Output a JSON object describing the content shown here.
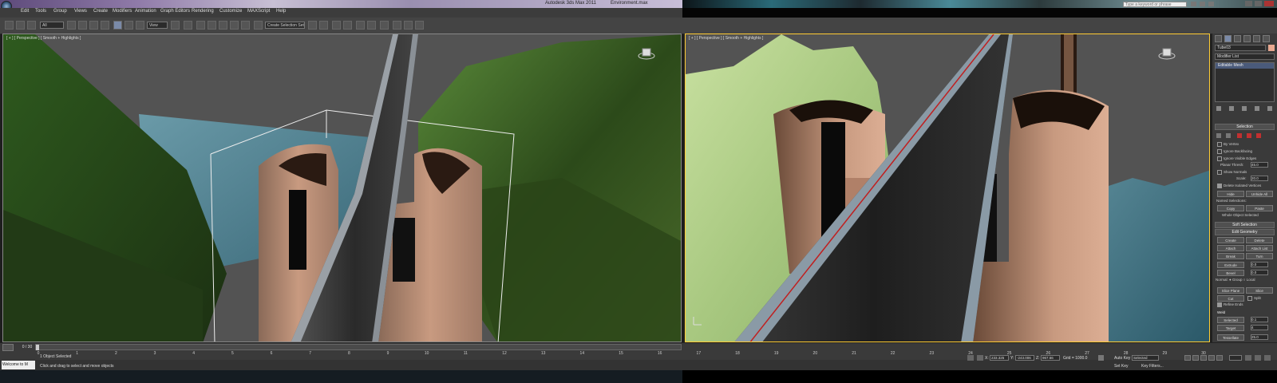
{
  "window": {
    "title_left": "Autodesk 3ds Max 2011",
    "title_right": "Environment.max",
    "search_placeholder": "Type a keyword or phrase"
  },
  "menu": [
    "Edit",
    "Tools",
    "Group",
    "Views",
    "Create",
    "Modifiers",
    "Animation",
    "Graph Editors",
    "Rendering",
    "Customize",
    "MAXScript",
    "Help"
  ],
  "toolbar": {
    "selection_filter": "All",
    "reference_coord": "View",
    "named_selection_set": "Create Selection Set"
  },
  "viewports": {
    "left": {
      "label": "[ + ] [ Perspective ] [ Smooth + Highlights ]"
    },
    "right": {
      "label": "[ + ] [ Perspective ] [ Smooth + Highlights ]"
    }
  },
  "command_panel": {
    "object_name": "Tube03",
    "modifier_list": "Modifier List",
    "stack_item": "Editable Mesh",
    "selection": {
      "title": "Selection",
      "by_vertex": "By Vertex",
      "ignore_backfacing": "Ignore Backfacing",
      "ignore_visible_edges": "Ignore Visible Edges",
      "planar_thresh": "Planar Thresh:",
      "planar_thresh_value": "45.0",
      "show_normals": "Show Normals",
      "scale": "Scale:",
      "scale_value": "20.0",
      "delete_isolated": "Delete Isolated Vertices",
      "hide": "Hide",
      "unhide_all": "Unhide All",
      "named_selections": "Named Selections:",
      "copy": "Copy",
      "paste": "Paste",
      "whole_object_selected": "Whole Object Selected"
    },
    "soft_selection": "Soft Selection",
    "edit_geometry": {
      "title": "Edit Geometry",
      "create": "Create",
      "delete": "Delete",
      "attach": "Attach",
      "attach_list": "Attach List",
      "break": "Break",
      "turn": "Turn",
      "extrude": "Extrude",
      "extrude_value": "0.0",
      "bevel": "Bevel",
      "bevel_value": "0.0",
      "normal": "Normal:",
      "group": "Group",
      "local": "Local",
      "slice_plane": "Slice Plane",
      "slice": "Slice",
      "cut": "Cut",
      "split": "Split",
      "refine_ends": "Refine Ends",
      "weld": "Weld",
      "selected": "Selected",
      "selected_value": "0.1",
      "target": "Target",
      "target_value": "4",
      "tessellate": "Tessellate",
      "tessellate_value": "25.0",
      "by_edge": "Edge",
      "face_center": "Face-Center"
    }
  },
  "timeline": {
    "slider_label": "0 / 30",
    "frames": [
      "0",
      "1",
      "2",
      "3",
      "4",
      "5",
      "6",
      "7",
      "8",
      "9",
      "10",
      "11",
      "12",
      "13",
      "14",
      "15",
      "16",
      "17",
      "18",
      "19",
      "20",
      "21",
      "22",
      "23",
      "24",
      "25",
      "26",
      "27",
      "28",
      "29",
      "30"
    ],
    "current_fraction": 0.0
  },
  "status": {
    "maxscript": "Welcome to M",
    "objects_selected": "1 Object Selected",
    "prompt": "Click and drag to select and move objects",
    "x_label": "X:",
    "x_value": "233.325",
    "y_label": "Y:",
    "y_value": "-243.006",
    "z_label": "Z:",
    "z_value": "967.66",
    "grid": "Grid = 1000.0",
    "auto_key": "Auto Key",
    "key_filter": "Selected",
    "set_key": "Set Key",
    "key_filters_btn": "Key Filters..."
  }
}
